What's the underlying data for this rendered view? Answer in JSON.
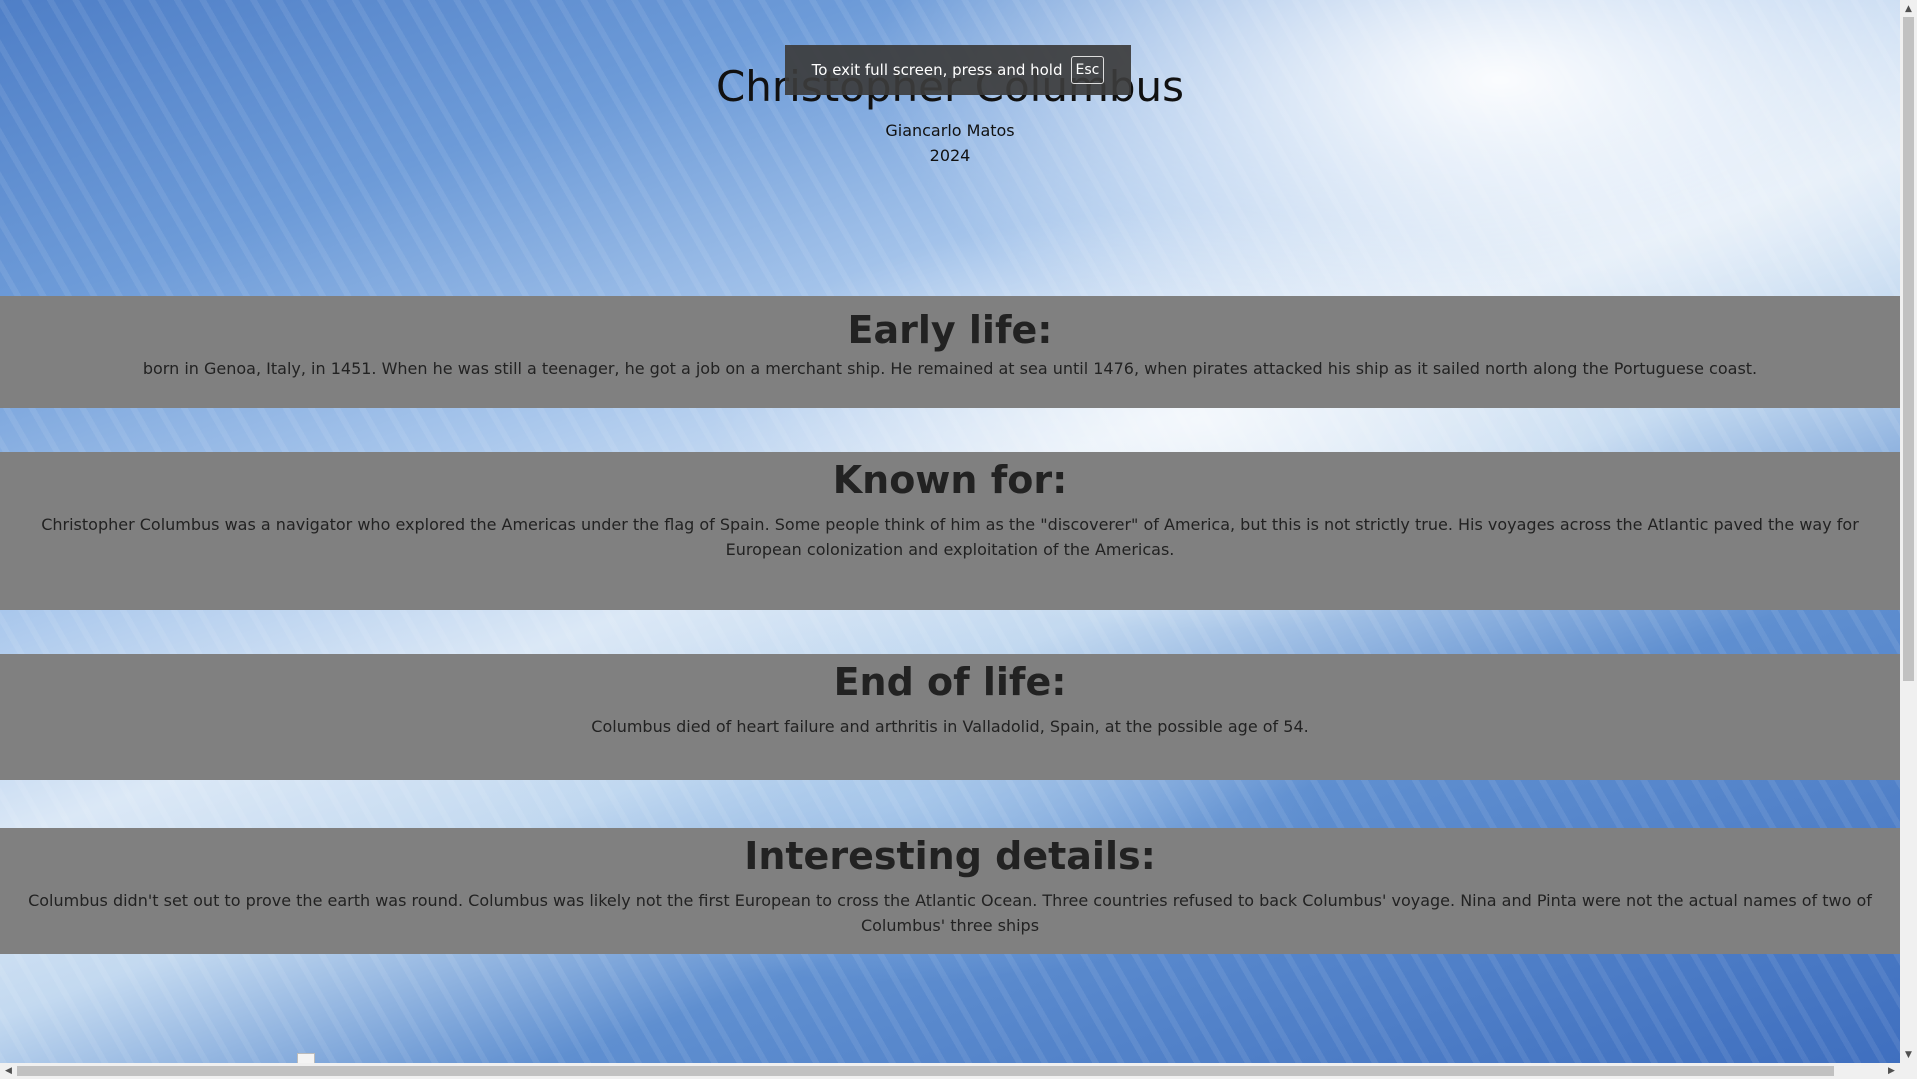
{
  "hero": {
    "title": "Christopher Columbus",
    "author": "Giancarlo Matos",
    "year": "2024"
  },
  "sections": [
    {
      "heading": "Early life:",
      "text": "born in Genoa, Italy, in 1451. When he was still a teenager, he got a job on a merchant ship. He remained at sea until 1476, when pirates attacked his ship as it sailed north along the Portuguese coast."
    },
    {
      "heading": "Known for:",
      "text": "Christopher Columbus was a navigator who explored the Americas under the flag of Spain. Some people think of him as the \"discoverer\" of America, but this is not strictly true. His voyages across the Atlantic paved the way for European colonization and exploitation of the Americas."
    },
    {
      "heading": "End of life:",
      "text": "Columbus died of heart failure and arthritis in Valladolid, Spain, at the possible age of 54."
    },
    {
      "heading": "Interesting details:",
      "text": "Columbus didn't set out to prove the earth was round. Columbus was likely not the first European to cross the Atlantic Ocean. Three countries refused to back Columbus' voyage. Nina and Pinta were not the actual names of two of Columbus' three ships"
    }
  ],
  "fullscreen_notice": {
    "text": "To exit full screen, press and hold",
    "key": "Esc"
  },
  "scrollbars": {
    "up_icon": "triangle-up-icon",
    "down_icon": "triangle-down-icon",
    "left_icon": "triangle-left-icon",
    "right_icon": "triangle-right-icon"
  }
}
